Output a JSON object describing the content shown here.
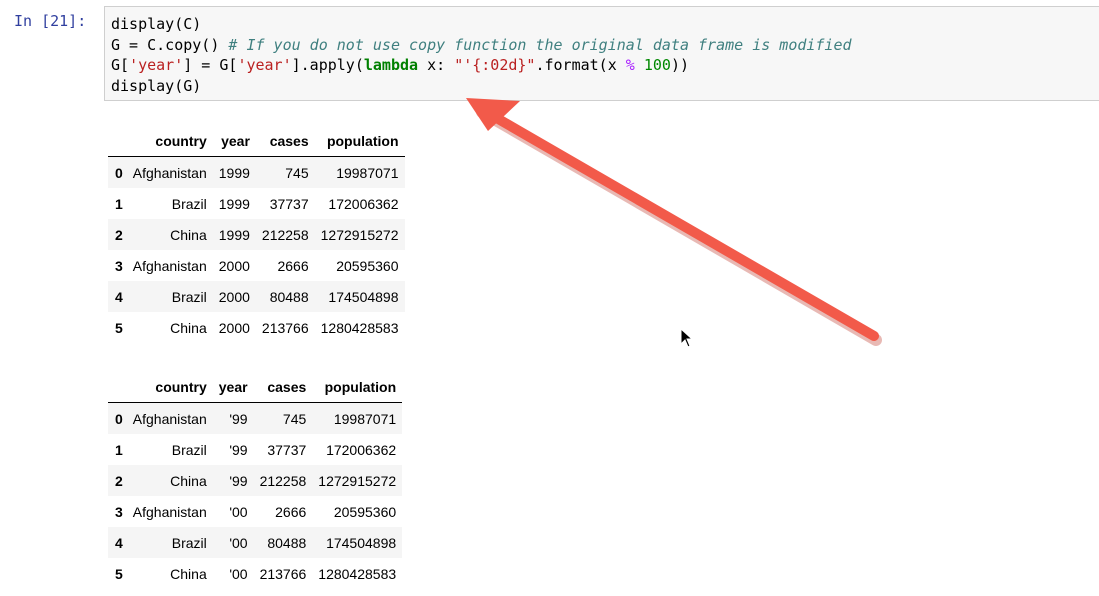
{
  "cell": {
    "prompt": "In [21]:",
    "lines": [
      [
        {
          "t": "display(C)",
          "c": ""
        }
      ],
      [
        {
          "t": "G = C.copy() ",
          "c": ""
        },
        {
          "t": "# If you do not use copy function the original data frame is modified",
          "c": "cm-comment"
        }
      ],
      [
        {
          "t": "G[",
          "c": ""
        },
        {
          "t": "'year'",
          "c": "cm-string"
        },
        {
          "t": "] = G[",
          "c": ""
        },
        {
          "t": "'year'",
          "c": "cm-string"
        },
        {
          "t": "].apply(",
          "c": ""
        },
        {
          "t": "lambda",
          "c": "cm-keyword"
        },
        {
          "t": " x: ",
          "c": ""
        },
        {
          "t": "\"'{:02d}\"",
          "c": "cm-string"
        },
        {
          "t": ".format(x ",
          "c": ""
        },
        {
          "t": "%",
          "c": "cm-op"
        },
        {
          "t": " ",
          "c": ""
        },
        {
          "t": "100",
          "c": "cm-number"
        },
        {
          "t": "))",
          "c": ""
        }
      ],
      [
        {
          "t": "display(G)",
          "c": ""
        }
      ]
    ]
  },
  "tables": [
    {
      "columns": [
        "",
        "country",
        "year",
        "cases",
        "population"
      ],
      "rows": [
        [
          "0",
          "Afghanistan",
          "1999",
          "745",
          "19987071"
        ],
        [
          "1",
          "Brazil",
          "1999",
          "37737",
          "172006362"
        ],
        [
          "2",
          "China",
          "1999",
          "212258",
          "1272915272"
        ],
        [
          "3",
          "Afghanistan",
          "2000",
          "2666",
          "20595360"
        ],
        [
          "4",
          "Brazil",
          "2000",
          "80488",
          "174504898"
        ],
        [
          "5",
          "China",
          "2000",
          "213766",
          "1280428583"
        ]
      ]
    },
    {
      "columns": [
        "",
        "country",
        "year",
        "cases",
        "population"
      ],
      "rows": [
        [
          "0",
          "Afghanistan",
          "'99",
          "745",
          "19987071"
        ],
        [
          "1",
          "Brazil",
          "'99",
          "37737",
          "172006362"
        ],
        [
          "2",
          "China",
          "'99",
          "212258",
          "1272915272"
        ],
        [
          "3",
          "Afghanistan",
          "'00",
          "2666",
          "20595360"
        ],
        [
          "4",
          "Brazil",
          "'00",
          "80488",
          "174504898"
        ],
        [
          "5",
          "China",
          "'00",
          "213766",
          "1280428583"
        ]
      ]
    }
  ],
  "annotation": {
    "arrow_color": "#f25a4a",
    "arrow_shadow": "#c0392b"
  },
  "icons": {
    "cursor": "mouse-pointer-icon",
    "arrow": "annotation-arrow-icon"
  }
}
